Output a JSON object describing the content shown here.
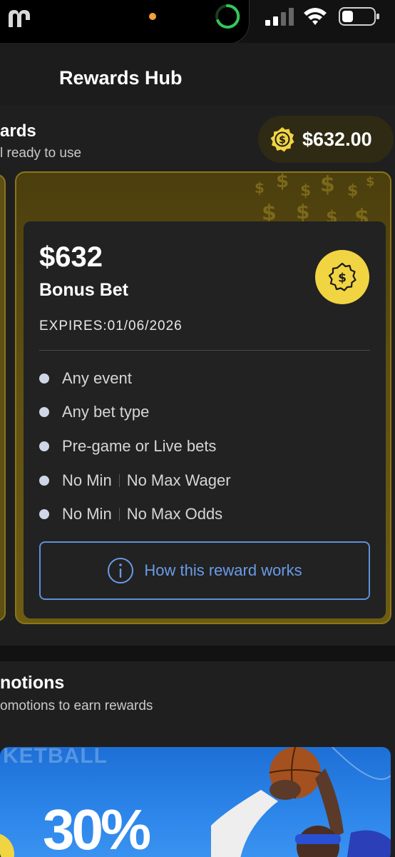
{
  "page": {
    "title": "Rewards Hub"
  },
  "status_bar": {
    "icons": [
      "app-icon",
      "privacy-dot",
      "activity-ring",
      "signal-icon",
      "wifi-icon",
      "battery-icon"
    ]
  },
  "rewards": {
    "title": "ards",
    "subtitle": "l ready to use",
    "balance": "$632.00",
    "card": {
      "amount": "$632",
      "label": "Bonus Bet",
      "expires": "EXPIRES:01/06/2026",
      "rules": [
        {
          "left": "Any event"
        },
        {
          "left": "Any bet type"
        },
        {
          "left": "Pre-game or Live bets"
        },
        {
          "left": "No Min",
          "right": "No Max Wager"
        },
        {
          "left": "No Min",
          "right": "No Max Odds"
        }
      ],
      "how_button": "How this reward works"
    }
  },
  "promotions": {
    "title": "notions",
    "subtitle": "omotions to earn rewards",
    "banner_bg_text": "KETBALL",
    "banner_percent": "30%"
  },
  "colors": {
    "accent_gold": "#f1d442",
    "link_blue": "#6a9be8",
    "card_gold": "#5f5012"
  }
}
